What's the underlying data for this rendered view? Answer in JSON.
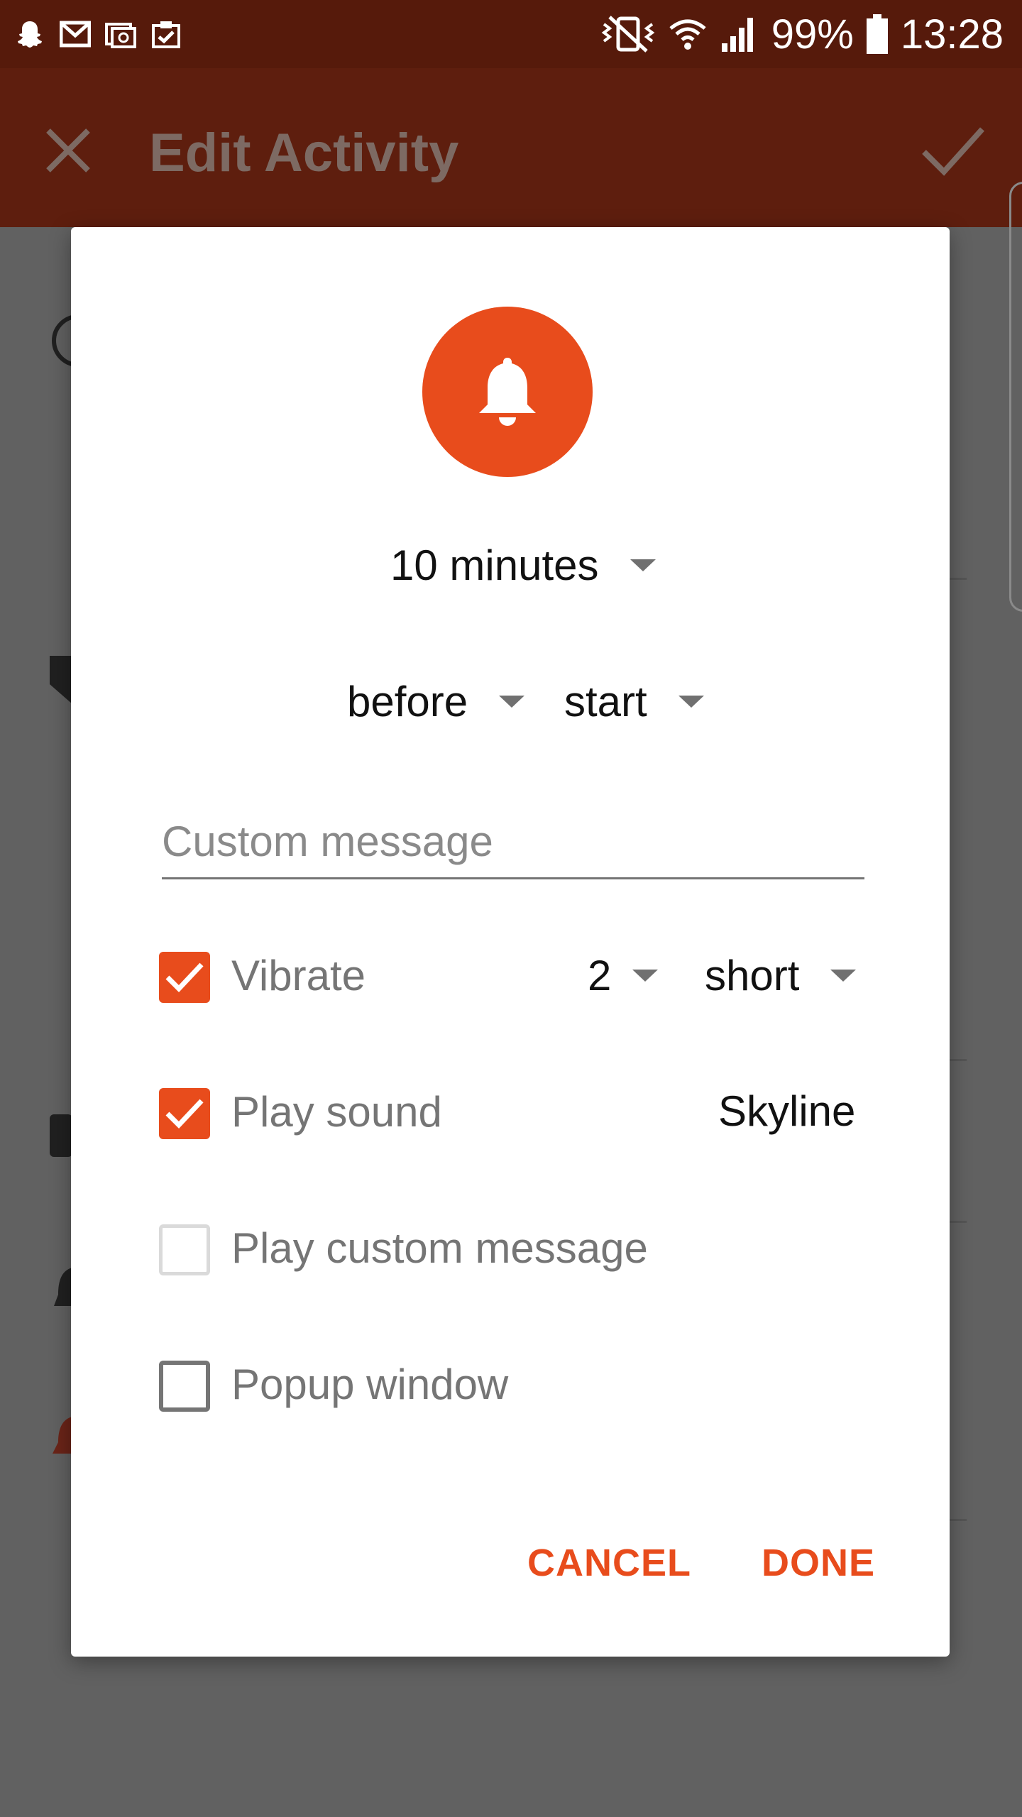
{
  "status_bar": {
    "battery": "99%",
    "time": "13:28",
    "icons": [
      "snapchat-icon",
      "gmail-icon",
      "email-icon",
      "clipboard-check-icon",
      "vibrate-mute-icon",
      "wifi-icon",
      "signal-icon",
      "battery-icon"
    ]
  },
  "toolbar": {
    "title": "Edit Activity",
    "close_icon": "close-icon",
    "confirm_icon": "check-icon"
  },
  "dialog": {
    "icon": "bell-icon",
    "accent_color": "#e84c1c",
    "offset": {
      "value": "10 minutes"
    },
    "relation": {
      "value": "before"
    },
    "anchor": {
      "value": "start"
    },
    "custom_message": {
      "value": "",
      "placeholder": "Custom message"
    },
    "options": {
      "vibrate": {
        "label": "Vibrate",
        "checked": true,
        "count": "2",
        "pattern": "short"
      },
      "play_sound": {
        "label": "Play sound",
        "checked": true,
        "sound": "Skyline"
      },
      "play_custom_message": {
        "label": "Play custom message",
        "checked": false,
        "enabled": false
      },
      "popup_window": {
        "label": "Popup window",
        "checked": false
      }
    },
    "buttons": {
      "cancel": "CANCEL",
      "done": "DONE"
    }
  }
}
